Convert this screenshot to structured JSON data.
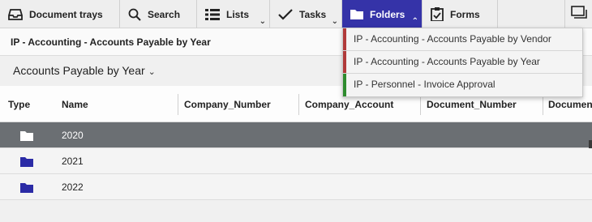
{
  "toolbar": {
    "items": [
      {
        "label": "Document trays",
        "icon": "tray-icon"
      },
      {
        "label": "Search",
        "icon": "search-icon"
      },
      {
        "label": "Lists",
        "icon": "list-icon"
      },
      {
        "label": "Tasks",
        "icon": "checkmark-icon"
      },
      {
        "label": "Folders",
        "icon": "folder-icon"
      },
      {
        "label": "Forms",
        "icon": "clipboard-icon"
      }
    ],
    "end_icon": "window-icon",
    "active_color": "#3533a8"
  },
  "breadcrumb": "IP - Accounting - Accounts Payable by Year",
  "view": {
    "title": "Accounts Payable by Year"
  },
  "table": {
    "columns": [
      "Type",
      "Name",
      "Company_Number",
      "Company_Account",
      "Document_Number",
      "Document"
    ],
    "rows": [
      {
        "name": "2020",
        "selected": true
      },
      {
        "name": "2021",
        "selected": false
      },
      {
        "name": "2022",
        "selected": false
      }
    ],
    "folder_color": "#2b2ba6",
    "selected_color": "#6b6f73"
  },
  "folders_menu": {
    "items": [
      {
        "label": "IP - Accounting - Accounts Payable by Vendor",
        "color": "#b03a3a"
      },
      {
        "label": "IP - Accounting - Accounts Payable by Year",
        "color": "#b03a3a"
      },
      {
        "label": "IP - Personnel - Invoice Approval",
        "color": "#2e8b2e"
      }
    ]
  }
}
